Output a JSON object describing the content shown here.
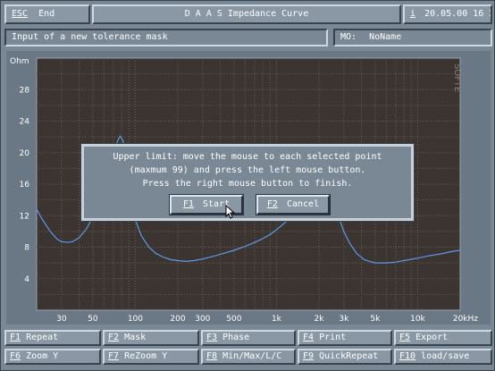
{
  "header": {
    "esc_key": "ESC",
    "esc_label": "End",
    "title": "D A A S  Impedance Curve",
    "info_key": "i",
    "datetime": "20.05.00 16 20"
  },
  "status": {
    "message": "Input of a new tolerance mask",
    "mo_label": "MO:",
    "mo_value": "NoName"
  },
  "watermark": "SOFTE",
  "chart_data": {
    "type": "line",
    "title": "",
    "ylabel": "Ohm",
    "xlabel": "",
    "x_scale": "log",
    "xlim": [
      20,
      20000
    ],
    "ylim": [
      0,
      32
    ],
    "grid": true,
    "y_ticks": [
      {
        "value": 4,
        "label": "4"
      },
      {
        "value": 8,
        "label": "8"
      },
      {
        "value": 12,
        "label": "12"
      },
      {
        "value": 16,
        "label": "16"
      },
      {
        "value": 20,
        "label": "20"
      },
      {
        "value": 24,
        "label": "24"
      },
      {
        "value": 28,
        "label": "28"
      }
    ],
    "x_ticks": [
      {
        "value": 30,
        "label": "30"
      },
      {
        "value": 50,
        "label": "50"
      },
      {
        "value": 100,
        "label": "100"
      },
      {
        "value": 200,
        "label": "200"
      },
      {
        "value": 300,
        "label": "300"
      },
      {
        "value": 500,
        "label": "500"
      },
      {
        "value": 1000,
        "label": "1k"
      },
      {
        "value": 2000,
        "label": "2k"
      },
      {
        "value": 3000,
        "label": "3k"
      },
      {
        "value": 5000,
        "label": "5k"
      },
      {
        "value": 10000,
        "label": "10k"
      },
      {
        "value": 20000,
        "label": "20kHz"
      }
    ],
    "series": [
      {
        "color": "#5a9ae8",
        "points": [
          [
            20,
            12.8
          ],
          [
            22,
            11.5
          ],
          [
            25,
            10.0
          ],
          [
            28,
            9.0
          ],
          [
            30,
            8.7
          ],
          [
            33,
            8.6
          ],
          [
            36,
            8.7
          ],
          [
            40,
            9.2
          ],
          [
            45,
            10.3
          ],
          [
            50,
            11.8
          ],
          [
            55,
            13.8
          ],
          [
            60,
            16.0
          ],
          [
            65,
            18.3
          ],
          [
            70,
            20.0
          ],
          [
            75,
            21.5
          ],
          [
            78,
            22.1
          ],
          [
            82,
            21.5
          ],
          [
            86,
            19.0
          ],
          [
            92,
            15.0
          ],
          [
            100,
            11.5
          ],
          [
            110,
            9.5
          ],
          [
            125,
            8.0
          ],
          [
            140,
            7.2
          ],
          [
            160,
            6.7
          ],
          [
            180,
            6.4
          ],
          [
            200,
            6.3
          ],
          [
            230,
            6.2
          ],
          [
            260,
            6.3
          ],
          [
            300,
            6.5
          ],
          [
            350,
            6.8
          ],
          [
            400,
            7.1
          ],
          [
            500,
            7.6
          ],
          [
            600,
            8.1
          ],
          [
            700,
            8.6
          ],
          [
            800,
            9.1
          ],
          [
            900,
            9.6
          ],
          [
            1000,
            10.2
          ],
          [
            1200,
            11.4
          ],
          [
            1400,
            12.8
          ],
          [
            1600,
            14.0
          ],
          [
            1800,
            14.6
          ],
          [
            2000,
            14.8
          ],
          [
            2200,
            14.5
          ],
          [
            2500,
            13.5
          ],
          [
            2800,
            11.5
          ],
          [
            3000,
            10.0
          ],
          [
            3300,
            8.5
          ],
          [
            3700,
            7.2
          ],
          [
            4200,
            6.4
          ],
          [
            5000,
            6.0
          ],
          [
            6000,
            6.0
          ],
          [
            7000,
            6.1
          ],
          [
            8000,
            6.3
          ],
          [
            10000,
            6.6
          ],
          [
            12000,
            6.9
          ],
          [
            15000,
            7.2
          ],
          [
            18000,
            7.5
          ],
          [
            20000,
            7.6
          ]
        ]
      }
    ]
  },
  "dialog": {
    "lines": [
      "Upper limit: move the mouse to each selected point",
      "(maxmum 99) and press the left mouse button.",
      "Press the right mouse button to finish."
    ],
    "start_key": "F1",
    "start_label": "Start",
    "cancel_key": "F2",
    "cancel_label": "Cancel"
  },
  "fkeys": {
    "row1": [
      {
        "key": "F1",
        "label": "Repeat"
      },
      {
        "key": "F2",
        "label": "Mask"
      },
      {
        "key": "F3",
        "label": "Phase"
      },
      {
        "key": "F4",
        "label": "Print"
      },
      {
        "key": "F5",
        "label": "Export"
      }
    ],
    "row2": [
      {
        "key": "F6",
        "label": "Zoom Y"
      },
      {
        "key": "F7",
        "label": "ReZoom Y"
      },
      {
        "key": "F8",
        "label": "Min/Max/L/C"
      },
      {
        "key": "F9",
        "label": "QuickRepeat"
      },
      {
        "key": "F10",
        "label": "load/save"
      }
    ]
  },
  "colors": {
    "plot_bg": "#3c3430",
    "grid": "#6a5e58",
    "curve": "#5a9ae8",
    "frame": "#7a8896"
  }
}
